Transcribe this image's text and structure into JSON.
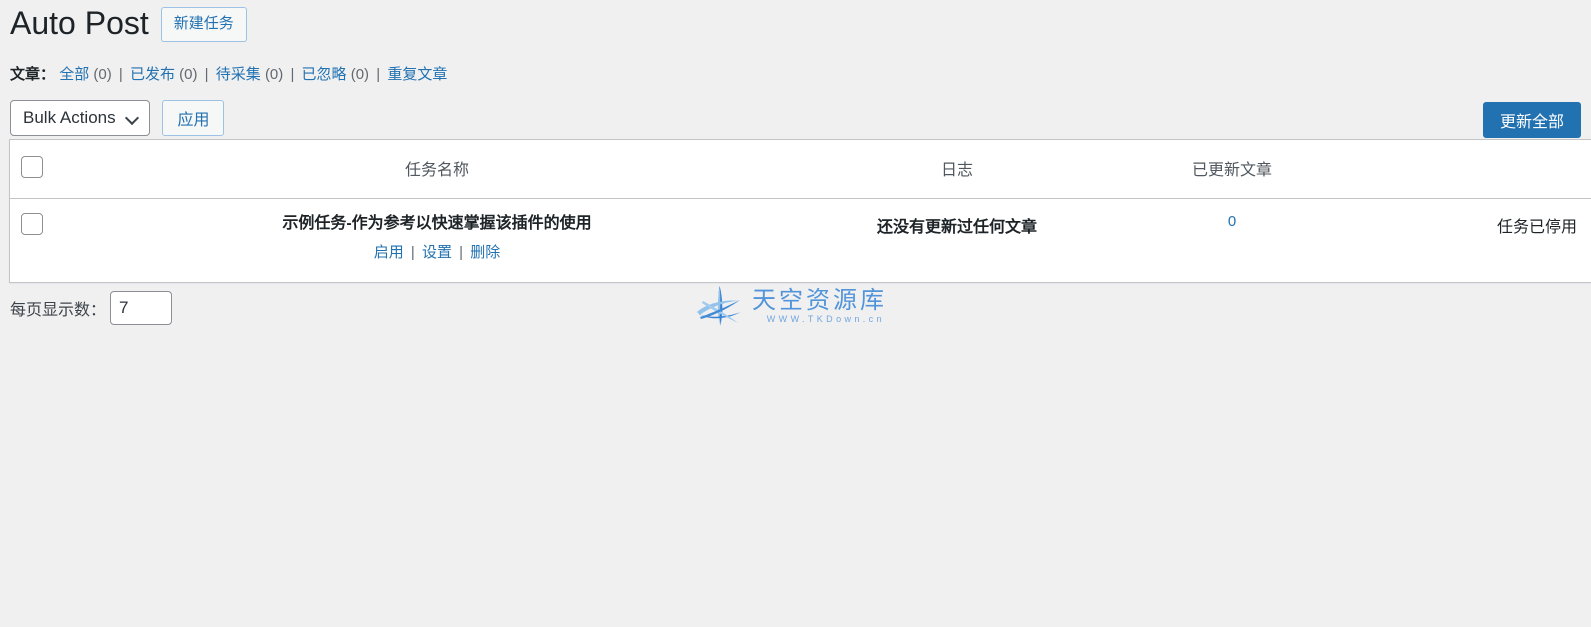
{
  "header": {
    "title": "Auto Post",
    "new_task_button": "新建任务"
  },
  "filters": {
    "label": "文章：",
    "separator": "|",
    "items": [
      {
        "label": "全部",
        "count": "(0)"
      },
      {
        "label": "已发布",
        "count": "(0)"
      },
      {
        "label": "待采集",
        "count": "(0)"
      },
      {
        "label": "已忽略",
        "count": "(0)"
      },
      {
        "label": "重复文章",
        "count": ""
      }
    ]
  },
  "tablenav": {
    "bulk_actions_label": "Bulk Actions",
    "bulk_actions_icon": "chevron-down-icon",
    "apply_label": "应用",
    "update_all_label": "更新全部"
  },
  "table": {
    "columns": {
      "checkbox": "",
      "name": "任务名称",
      "log": "日志",
      "updated": "已更新文章",
      "status": ""
    },
    "rows": [
      {
        "title": "示例任务-作为参考以快速掌握该插件的使用",
        "actions": [
          {
            "label": "启用"
          },
          {
            "label": "设置"
          },
          {
            "label": "删除"
          }
        ],
        "action_separator": "|",
        "log": "还没有更新过任何文章",
        "updated": "0",
        "status": "任务已停用"
      }
    ]
  },
  "footer": {
    "per_page_label": "每页显示数：",
    "per_page_value": "7"
  },
  "watermark": {
    "title": "天空资源库",
    "url": "WWW.TKDown.cn",
    "logo_icon": "star-swoosh-logo-icon"
  },
  "colors": {
    "page_background": "#f0f0f1",
    "link": "#2271b1",
    "primary_button": "#2271b1",
    "border": "#c3c4c7",
    "watermark_blue": "#4a90d9"
  }
}
